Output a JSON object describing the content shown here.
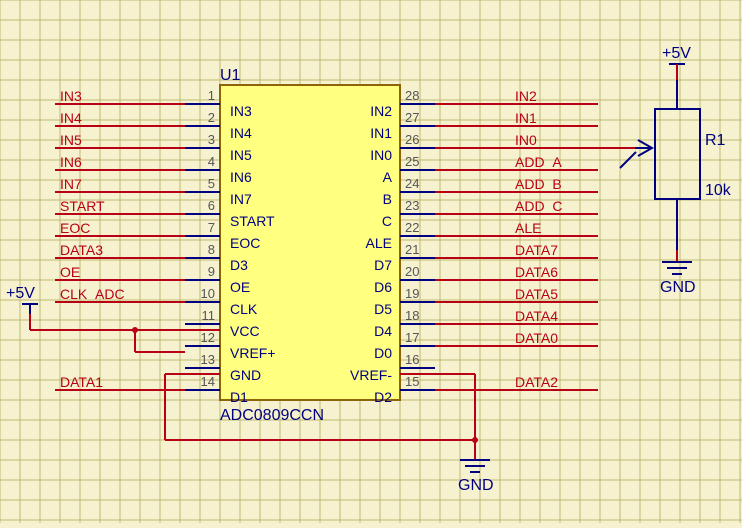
{
  "schematic": {
    "refdes_u1": "U1",
    "part_u1": "ADC0809CCN",
    "refdes_r1": "R1",
    "value_r1": "10k",
    "power_5v_1": "+5V",
    "power_5v_2": "+5V",
    "gnd_1": "GND",
    "gnd_2": "GND",
    "left": [
      {
        "num": "1",
        "lbl": "IN3",
        "net": "IN3"
      },
      {
        "num": "2",
        "lbl": "IN4",
        "net": "IN4"
      },
      {
        "num": "3",
        "lbl": "IN5",
        "net": "IN5"
      },
      {
        "num": "4",
        "lbl": "IN6",
        "net": "IN6"
      },
      {
        "num": "5",
        "lbl": "IN7",
        "net": "IN7"
      },
      {
        "num": "6",
        "lbl": "START",
        "net": "START"
      },
      {
        "num": "7",
        "lbl": "EOC",
        "net": "EOC"
      },
      {
        "num": "8",
        "lbl": "D3",
        "net": "DATA3"
      },
      {
        "num": "9",
        "lbl": "OE",
        "net": "OE"
      },
      {
        "num": "10",
        "lbl": "CLK",
        "net": "CLK_ADC"
      },
      {
        "num": "11",
        "lbl": "VCC",
        "net": ""
      },
      {
        "num": "12",
        "lbl": "VREF+",
        "net": ""
      },
      {
        "num": "13",
        "lbl": "GND",
        "net": ""
      },
      {
        "num": "14",
        "lbl": "D1",
        "net": "DATA1"
      }
    ],
    "right": [
      {
        "num": "28",
        "lbl": "IN2",
        "net": "IN2"
      },
      {
        "num": "27",
        "lbl": "IN1",
        "net": "IN1"
      },
      {
        "num": "26",
        "lbl": "IN0",
        "net": "IN0"
      },
      {
        "num": "25",
        "lbl": "A",
        "net": "ADD_A"
      },
      {
        "num": "24",
        "lbl": "B",
        "net": "ADD_B"
      },
      {
        "num": "23",
        "lbl": "C",
        "net": "ADD_C"
      },
      {
        "num": "22",
        "lbl": "ALE",
        "net": "ALE"
      },
      {
        "num": "21",
        "lbl": "D7",
        "net": "DATA7"
      },
      {
        "num": "20",
        "lbl": "D6",
        "net": "DATA6"
      },
      {
        "num": "19",
        "lbl": "D5",
        "net": "DATA5"
      },
      {
        "num": "18",
        "lbl": "D4",
        "net": "DATA4"
      },
      {
        "num": "17",
        "lbl": "D0",
        "net": "DATA0"
      },
      {
        "num": "16",
        "lbl": "VREF-",
        "net": ""
      },
      {
        "num": "15",
        "lbl": "D2",
        "net": "DATA2"
      }
    ]
  }
}
